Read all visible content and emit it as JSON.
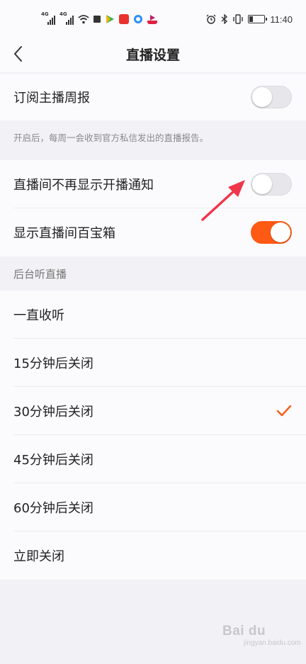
{
  "status_bar": {
    "network_1": "4G",
    "network_2": "4G",
    "time": "11:40"
  },
  "nav": {
    "title": "直播设置"
  },
  "settings": {
    "weekly_report": {
      "label": "订阅主播周报",
      "enabled": false
    },
    "weekly_report_hint": "开启后，每周一会收到官方私信发出的直播报告。",
    "hide_start_notice": {
      "label": "直播间不再显示开播通知",
      "enabled": false
    },
    "show_treasure_box": {
      "label": "显示直播间百宝箱",
      "enabled": true
    }
  },
  "background_listening": {
    "section_title": "后台听直播",
    "options": [
      {
        "label": "一直收听",
        "selected": false
      },
      {
        "label": "15分钟后关闭",
        "selected": false
      },
      {
        "label": "30分钟后关闭",
        "selected": true
      },
      {
        "label": "45分钟后关闭",
        "selected": false
      },
      {
        "label": "60分钟后关闭",
        "selected": false
      },
      {
        "label": "立即关闭",
        "selected": false
      }
    ]
  },
  "watermark": {
    "brand": "Bai du",
    "sub": "jingyan.baidu.com"
  },
  "colors": {
    "accent": "#ff5a14",
    "annotation_arrow": "#f0364a"
  },
  "icons": {
    "back": "chevron-left-icon",
    "check": "checkmark-icon"
  }
}
